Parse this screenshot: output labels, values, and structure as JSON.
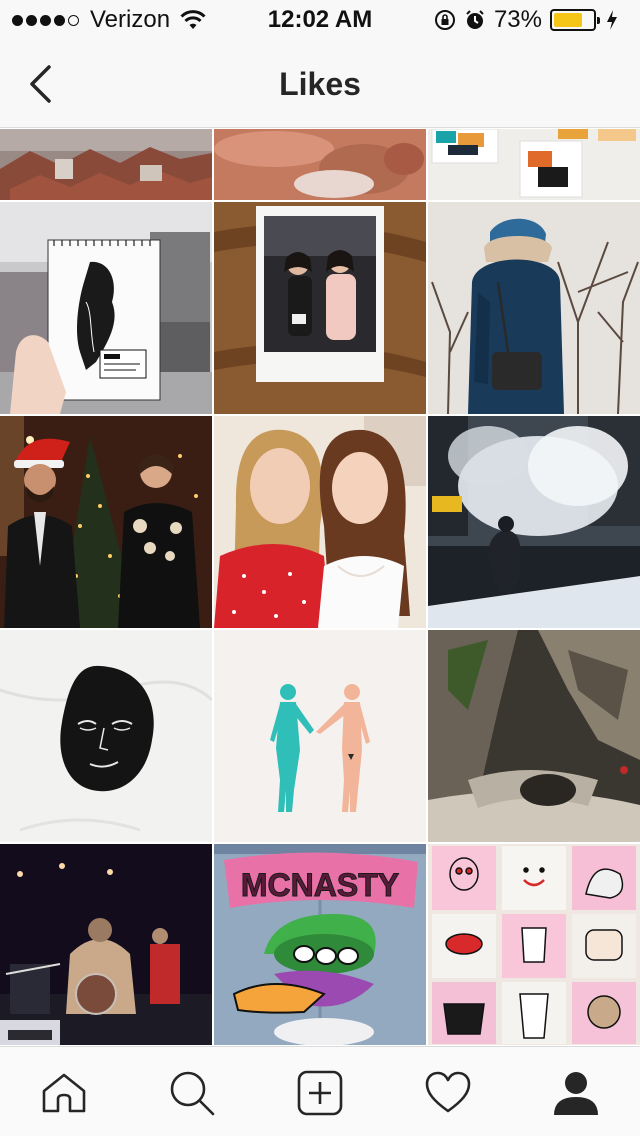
{
  "status_bar": {
    "carrier": "Verizon",
    "time": "12:02 AM",
    "battery_percent": "73%",
    "battery_level": 0.73,
    "signal_bars_filled": 4,
    "signal_bars_total": 5
  },
  "nav": {
    "title": "Likes",
    "back_icon": "chevron-left-icon"
  },
  "grid": {
    "columns": 3,
    "posts": [
      {
        "id": "post-1",
        "description": "rooftops"
      },
      {
        "id": "post-2",
        "description": "mineral texture"
      },
      {
        "id": "post-3",
        "description": "painted cards"
      },
      {
        "id": "post-4",
        "description": "sketchbook city"
      },
      {
        "id": "post-5",
        "description": "polaroid photo"
      },
      {
        "id": "post-6",
        "description": "winter parka"
      },
      {
        "id": "post-7",
        "description": "christmas portrait"
      },
      {
        "id": "post-8",
        "description": "two women selfie"
      },
      {
        "id": "post-9",
        "description": "steam street"
      },
      {
        "id": "post-10",
        "description": "black face print"
      },
      {
        "id": "post-11",
        "description": "two figures illustration"
      },
      {
        "id": "post-12",
        "description": "rocky waterfall"
      },
      {
        "id": "post-13",
        "description": "concert stage"
      },
      {
        "id": "post-14",
        "description": "denim jacket patch"
      },
      {
        "id": "post-15",
        "description": "illustrated tote bags"
      }
    ],
    "jacket_text": "MCNASTY"
  },
  "tab_bar": {
    "tabs": [
      {
        "name": "home",
        "icon": "home-icon",
        "active": false
      },
      {
        "name": "search",
        "icon": "search-icon",
        "active": false
      },
      {
        "name": "new-post",
        "icon": "plus-square-icon",
        "active": false
      },
      {
        "name": "activity",
        "icon": "heart-icon",
        "active": false
      },
      {
        "name": "profile",
        "icon": "person-icon",
        "active": true
      }
    ]
  },
  "colors": {
    "bar_background": "#f8f8f8",
    "text": "#262626",
    "battery": "#f5c518"
  }
}
